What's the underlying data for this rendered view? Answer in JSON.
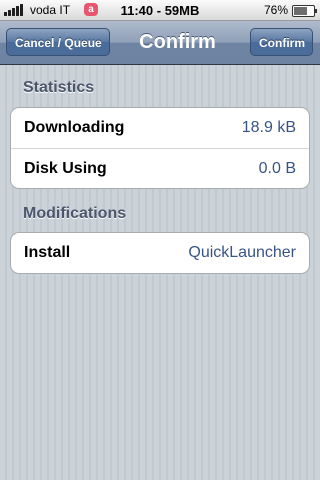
{
  "status_bar": {
    "carrier": "voda IT",
    "app_badge": "a",
    "time_text": "11:40 - 59MB",
    "battery_percent": "76%",
    "battery_level": 0.76
  },
  "nav": {
    "left_button": "Cancel / Queue",
    "title": "Confirm",
    "right_button": "Confirm"
  },
  "sections": [
    {
      "header": "Statistics",
      "rows": [
        {
          "label": "Downloading",
          "value": "18.9 kB"
        },
        {
          "label": "Disk Using",
          "value": "0.0 B"
        }
      ]
    },
    {
      "header": "Modifications",
      "rows": [
        {
          "label": "Install",
          "value": "QuickLauncher"
        }
      ]
    }
  ],
  "colors": {
    "navbar": "#6d83a1",
    "value_text": "#385487",
    "section_header": "#4c566c",
    "background": "#c5ccd4"
  }
}
